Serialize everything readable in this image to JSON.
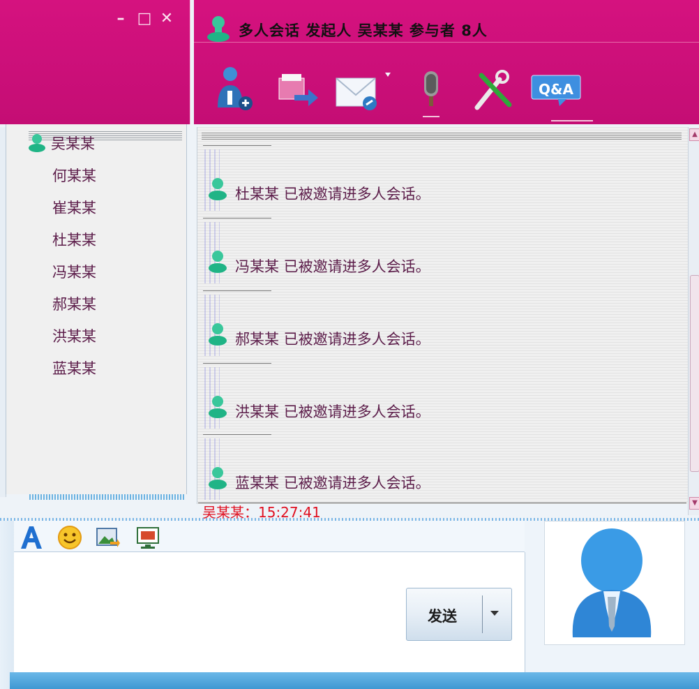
{
  "window": {
    "title": "多人会话 发起人 吴某某 参与者 8人",
    "controls": {
      "minimize": "–",
      "maximize": "□",
      "close": "✕"
    }
  },
  "toolbar": {
    "items": [
      {
        "name": "invite-user",
        "icon": "add-user-icon"
      },
      {
        "name": "send-file",
        "icon": "file-transfer-icon"
      },
      {
        "name": "email",
        "icon": "email-icon"
      },
      {
        "name": "voice",
        "icon": "microphone-icon"
      },
      {
        "name": "settings",
        "icon": "tools-icon"
      },
      {
        "name": "qa",
        "icon": "qa-icon",
        "label": "Q&A"
      }
    ]
  },
  "participants": [
    "吴某某",
    "何某某",
    "崔某某",
    "杜某某",
    "冯某某",
    "郝某某",
    "洪某某",
    "蓝某某"
  ],
  "messages": [
    "杜某某 已被邀请进多人会话。",
    "冯某某 已被邀请进多人会话。",
    "郝某某 已被邀请进多人会话。",
    "洪某某 已被邀请进多人会话。",
    "蓝某某 已被邀请进多人会话。"
  ],
  "last_message_header": "吴某某：15:27:41",
  "input_tools": [
    {
      "name": "font",
      "icon": "font-icon"
    },
    {
      "name": "emoji",
      "icon": "smiley-icon"
    },
    {
      "name": "image",
      "icon": "image-icon"
    },
    {
      "name": "screen",
      "icon": "screenshot-icon"
    }
  ],
  "send_button": {
    "label": "发送"
  },
  "colors": {
    "header_magenta": "#d0107b",
    "participant_text": "#5c1d4a",
    "timestamp_red": "#e01020",
    "bottom_bar_blue": "#4aa3dc"
  }
}
